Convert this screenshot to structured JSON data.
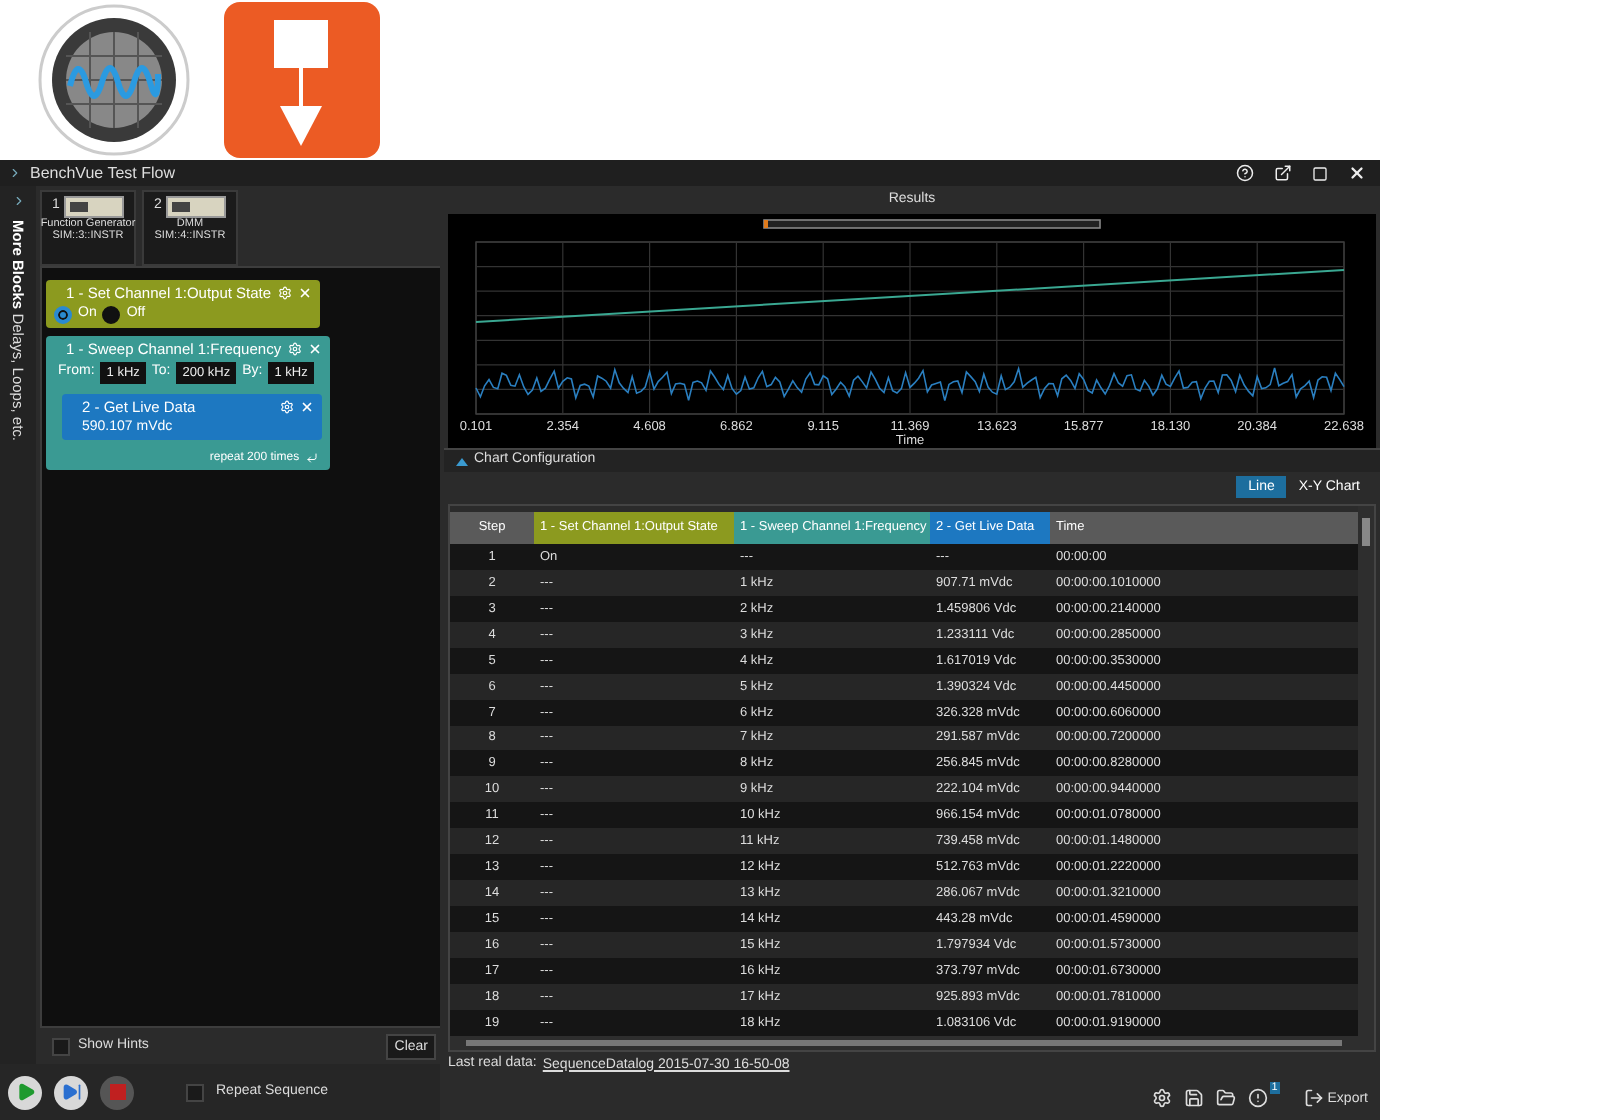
{
  "window": {
    "title": "BenchVue Test Flow"
  },
  "sidebar": {
    "label_bold": "More Blocks",
    "label": "Delays, Loops, etc."
  },
  "instruments": [
    {
      "number": "1",
      "name": "Function Generator",
      "address": "SIM::3::INSTR"
    },
    {
      "number": "2",
      "name": "DMM",
      "address": "SIM::4::INSTR"
    }
  ],
  "blocks": [
    {
      "kind": "state",
      "title": "1 - Set Channel 1:Output State",
      "color": "#8c9a1f",
      "options": [
        {
          "label": "On",
          "selected": true
        },
        {
          "label": "Off",
          "selected": false
        }
      ]
    },
    {
      "kind": "sweep",
      "title": "1 - Sweep Channel 1:Frequency",
      "color": "#3a9a93",
      "fields": [
        {
          "label": "From:",
          "value": "1 kHz"
        },
        {
          "label": "To:",
          "value": "200 kHz"
        },
        {
          "label": "By:",
          "value": "1 kHz"
        }
      ],
      "footer": "repeat 200 times",
      "children": [
        {
          "kind": "reading",
          "title": "2 - Get Live Data",
          "value": "590.107 mVdc",
          "color": "#1d78c1"
        }
      ]
    }
  ],
  "show_hints": {
    "label": "Show Hints",
    "checked": false
  },
  "clear_button": "Clear",
  "repeat_sequence": {
    "label": "Repeat Sequence",
    "checked": false
  },
  "results": {
    "title": "Results",
    "x_ticks": [
      "0.101",
      "2.354",
      "4.608",
      "6.862",
      "9.115",
      "11.369",
      "13.623",
      "15.877",
      "18.130",
      "20.384",
      "22.638"
    ],
    "x_label": "Time"
  },
  "chart_configuration": {
    "label": "Chart Configuration"
  },
  "chart_modes": [
    {
      "label": "Line",
      "selected": true
    },
    {
      "label": "X-Y Chart",
      "selected": false
    }
  ],
  "table": {
    "columns": [
      {
        "label": "Step",
        "color": "#5a5a5a"
      },
      {
        "label": "1 - Set Channel 1:Output State",
        "color": "#8c9a1f"
      },
      {
        "label": "1 - Sweep Channel 1:Frequency",
        "color": "#3a9a93"
      },
      {
        "label": "2 - Get Live Data",
        "color": "#1d78c1"
      },
      {
        "label": "Time",
        "color": "#5a5a5a"
      }
    ],
    "rows": [
      [
        "1",
        "On",
        "---",
        "---",
        "00:00:00"
      ],
      [
        "2",
        "---",
        "1 kHz",
        "907.71 mVdc",
        "00:00:00.1010000"
      ],
      [
        "3",
        "---",
        "2 kHz",
        "1.459806 Vdc",
        "00:00:00.2140000"
      ],
      [
        "4",
        "---",
        "3 kHz",
        "1.233111 Vdc",
        "00:00:00.2850000"
      ],
      [
        "5",
        "---",
        "4 kHz",
        "1.617019 Vdc",
        "00:00:00.3530000"
      ],
      [
        "6",
        "---",
        "5 kHz",
        "1.390324 Vdc",
        "00:00:00.4450000"
      ],
      [
        "7",
        "---",
        "6 kHz",
        "326.328 mVdc",
        "00:00:00.6060000"
      ],
      [
        "8",
        "---",
        "7 kHz",
        "291.587 mVdc",
        "00:00:00.7200000"
      ],
      [
        "9",
        "---",
        "8 kHz",
        "256.845 mVdc",
        "00:00:00.8280000"
      ],
      [
        "10",
        "---",
        "9 kHz",
        "222.104 mVdc",
        "00:00:00.9440000"
      ],
      [
        "11",
        "---",
        "10 kHz",
        "966.154 mVdc",
        "00:00:01.0780000"
      ],
      [
        "12",
        "---",
        "11 kHz",
        "739.458 mVdc",
        "00:00:01.1480000"
      ],
      [
        "13",
        "---",
        "12 kHz",
        "512.763 mVdc",
        "00:00:01.2220000"
      ],
      [
        "14",
        "---",
        "13 kHz",
        "286.067 mVdc",
        "00:00:01.3210000"
      ],
      [
        "15",
        "---",
        "14 kHz",
        "443.28 mVdc",
        "00:00:01.4590000"
      ],
      [
        "16",
        "---",
        "15 kHz",
        "1.797934 Vdc",
        "00:00:01.5730000"
      ],
      [
        "17",
        "---",
        "16 kHz",
        "373.797 mVdc",
        "00:00:01.6730000"
      ],
      [
        "18",
        "---",
        "17 kHz",
        "925.893 mVdc",
        "00:00:01.7810000"
      ],
      [
        "19",
        "---",
        "18 kHz",
        "1.083106 Vdc",
        "00:00:01.9190000"
      ]
    ]
  },
  "footer": {
    "label": "Last real data:",
    "link": "SequenceDatalog 2015-07-30 16-50-08"
  },
  "notification_count": "1",
  "export_button": "Export"
}
